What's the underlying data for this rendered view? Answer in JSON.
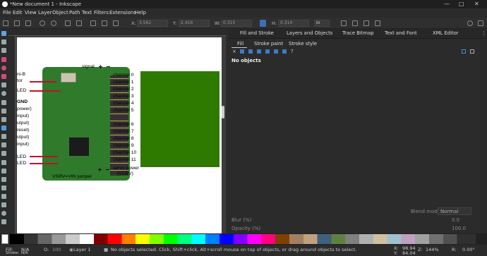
{
  "window": {
    "title": "*New document 1 - Inkscape"
  },
  "menu": [
    "File",
    "Edit",
    "View",
    "Layer",
    "Object",
    "Path",
    "Text",
    "Filters",
    "Extensions",
    "Help"
  ],
  "tool_controls": {
    "x_label": "X:",
    "x_value": "3.562",
    "y_label": "Y:",
    "y_value": "2.416",
    "w_label": "W:",
    "w_value": "0.315",
    "h_label": "H:",
    "h_value": "0.314",
    "unit": "in"
  },
  "canvas": {
    "labels_top": [
      "signal",
      "+",
      "−"
    ],
    "channels": [
      "channel 0",
      "channel 1",
      "channel 2",
      "channel 3",
      "channel 4",
      "channel 5",
      "channel 6",
      "channel 7",
      "channel 8",
      "channel 9",
      "channel 10",
      "channel 11"
    ],
    "left_labels": [
      "ni-B",
      "tor",
      "LED",
      "GND",
      "power)",
      "input)",
      "utput)",
      "reset)",
      "utput)",
      "input)",
      "LED",
      "LED"
    ],
    "servo_power": "servo power",
    "vsrv": "(VSRV)",
    "bottom_label": "VSRV=VIN jumper",
    "bottom_signs": [
      "+",
      "−"
    ],
    "rect_color": "#2e7a00"
  },
  "dock": {
    "tabs": [
      "Fill and Stroke",
      "Layers and Objects",
      "Trace Bitmap",
      "Text and Font",
      "XML Editor"
    ],
    "subtabs": [
      "Fill",
      "Stroke paint",
      "Stroke style"
    ],
    "message": "No objects",
    "blend_label": "Blend mode",
    "blend_value": "Normal",
    "blur_label": "Blur (%)",
    "blur_value": "0.0",
    "opacity_label": "Opacity (%)",
    "opacity_value": "100.0"
  },
  "status": {
    "fill_label": "Fill:",
    "fill_value": "N/A",
    "stroke_label": "Stroke:",
    "stroke_value": "N/A",
    "opacity_label": "O:",
    "opacity_value": "100",
    "layer": "Layer 1",
    "message": "No objects selected. Click, Shift+click, Alt+scroll mouse on top of objects, or drag around objects to select.",
    "x_label": "X:",
    "x_value": "98.94",
    "y_label": "Y:",
    "y_value": "84.04",
    "z_label": "Z:",
    "zoom": "144%",
    "r_label": "R:",
    "rotation": "0.00°"
  }
}
